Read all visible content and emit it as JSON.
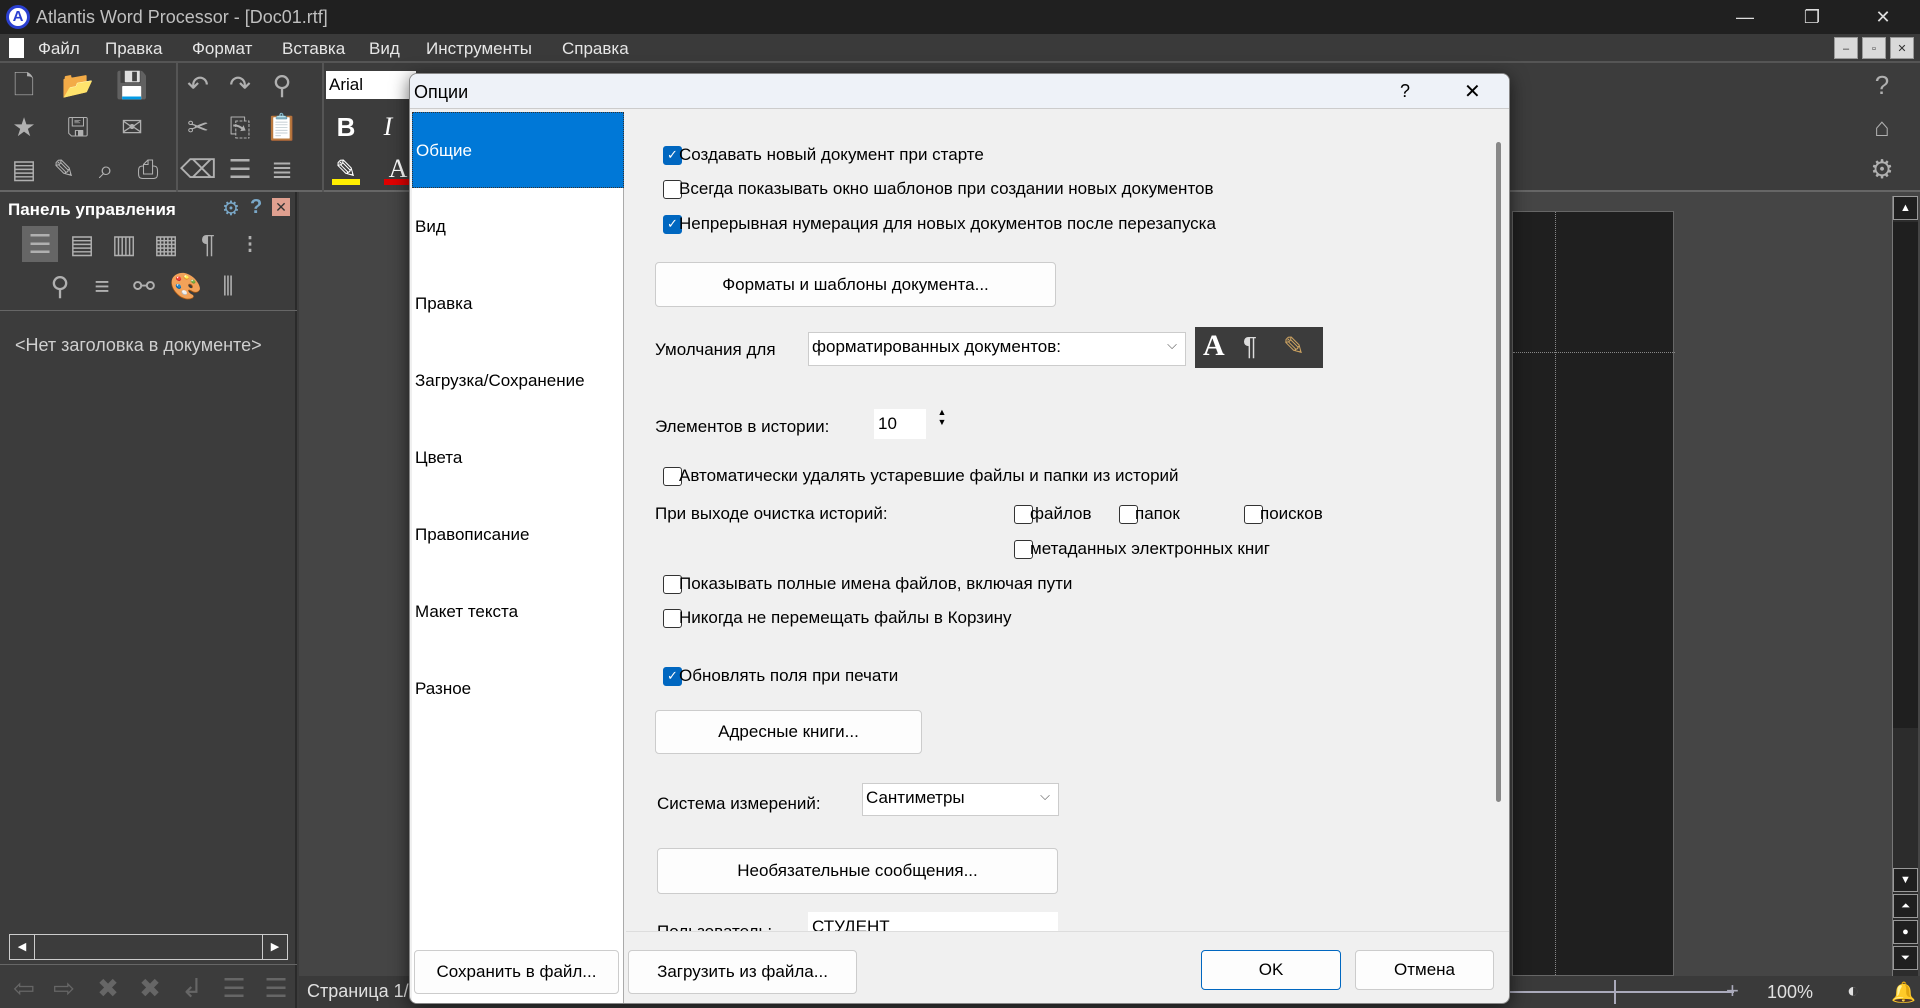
{
  "window": {
    "title": "Atlantis Word Processor - [Doc01.rtf]",
    "controls": [
      "—",
      "❐",
      "✕"
    ]
  },
  "menu": [
    "Файл",
    "Правка",
    "Формат",
    "Вставка",
    "Вид",
    "Инструменты",
    "Справка"
  ],
  "toolbar": {
    "font": "Arial",
    "bold": "B",
    "italic": "I",
    "underline_color": "#ffee00",
    "font_color": "#e00000"
  },
  "panel": {
    "title": "Панель управления",
    "no_heading": "<Нет заголовка в документе>"
  },
  "status": {
    "page": "Страница 1/",
    "zoom": "100%"
  },
  "dialog": {
    "title": "Опции",
    "help": "?",
    "close": "✕",
    "nav": [
      {
        "label": "Общие",
        "selected": true
      },
      {
        "label": "Вид"
      },
      {
        "label": "Правка"
      },
      {
        "label": "Загрузка/Сохранение"
      },
      {
        "label": "Цвета"
      },
      {
        "label": "Правописание"
      },
      {
        "label": "Макет текста"
      },
      {
        "label": "Разное"
      }
    ],
    "general": {
      "cb_new_doc": {
        "label": "Создавать новый документ при старте",
        "checked": true
      },
      "cb_templates": {
        "label": "Всегда показывать окно шаблонов при создании новых документов",
        "checked": false
      },
      "cb_numbering": {
        "label": "Непрерывная нумерация для новых документов после перезапуска",
        "checked": true
      },
      "formats_button": "Форматы и шаблоны документа...",
      "defaults_label": "Умолчания для",
      "defaults_value": "форматированных документов:",
      "history_label": "Элементов в истории:",
      "history_value": "10",
      "cb_autodelete": {
        "label": "Автоматически удалять устаревшие файлы и папки из историй",
        "checked": false
      },
      "clear_label": "При выходе очистка историй:",
      "clear_files": {
        "label": "файлов",
        "checked": false
      },
      "clear_folders": {
        "label": "папок",
        "checked": false
      },
      "clear_searches": {
        "label": "поисков",
        "checked": false
      },
      "clear_metadata": {
        "label": "метаданных электронных книг",
        "checked": false
      },
      "cb_fullnames": {
        "label": "Показывать полные имена файлов, включая пути",
        "checked": false
      },
      "cb_norecycle": {
        "label": "Никогда не перемещать файлы в Корзину",
        "checked": false
      },
      "cb_updatefields": {
        "label": "Обновлять поля при печати",
        "checked": true
      },
      "address_button": "Адресные книги...",
      "units_label": "Система измерений:",
      "units_value": "Сантиметры",
      "messages_button": "Необязательные сообщения...",
      "user_label": "Пользователь:",
      "user_value": "СТУДЕНТ"
    },
    "save_button": "Сохранить в файл...",
    "load_button": "Загрузить из файла...",
    "ok": "OK",
    "cancel": "Отмена"
  }
}
